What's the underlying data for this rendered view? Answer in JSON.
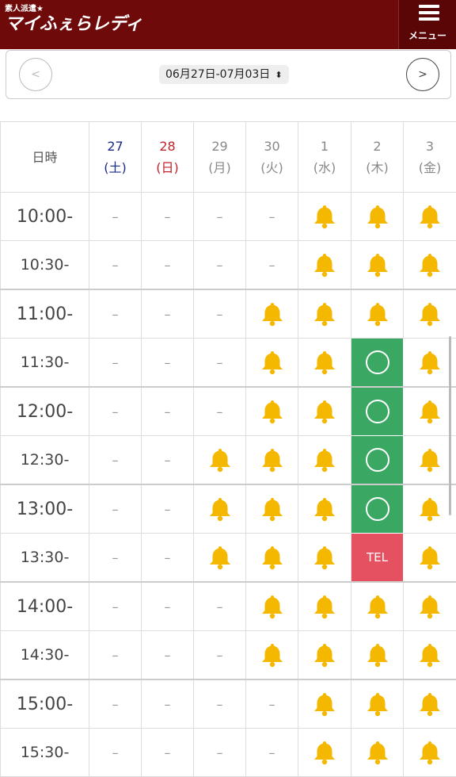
{
  "header": {
    "logo_sub": "素人派遣★",
    "logo_main": "マイふぇらレディ",
    "menu_label": "メニュー",
    "menu_icon": "hamburger-icon"
  },
  "date_nav": {
    "prev_label": "<",
    "next_label": ">",
    "range": "06月27日-07月03日",
    "selector_icon": "up-down-chevron-icon"
  },
  "table": {
    "corner_label": "日時",
    "days": [
      {
        "date": "27",
        "weekday": "(土)",
        "style": "sat"
      },
      {
        "date": "28",
        "weekday": "(日)",
        "style": "sun"
      },
      {
        "date": "29",
        "weekday": "(月)",
        "style": "normal"
      },
      {
        "date": "30",
        "weekday": "(火)",
        "style": "normal"
      },
      {
        "date": "1",
        "weekday": "(水)",
        "style": "normal"
      },
      {
        "date": "2",
        "weekday": "(木)",
        "style": "normal"
      },
      {
        "date": "3",
        "weekday": "(金)",
        "style": "normal"
      }
    ],
    "symbols": {
      "dash": "–",
      "tel": "TEL",
      "bell": "bell-icon",
      "open": "circle-icon"
    },
    "rows": [
      {
        "time": "10:00-",
        "cells": [
          "dash",
          "dash",
          "dash",
          "dash",
          "bell",
          "bell",
          "bell"
        ]
      },
      {
        "time": "10:30-",
        "cells": [
          "dash",
          "dash",
          "dash",
          "dash",
          "bell",
          "bell",
          "bell"
        ]
      },
      {
        "time": "11:00-",
        "cells": [
          "dash",
          "dash",
          "dash",
          "bell",
          "bell",
          "bell",
          "bell"
        ]
      },
      {
        "time": "11:30-",
        "cells": [
          "dash",
          "dash",
          "dash",
          "bell",
          "bell",
          "open",
          "bell"
        ]
      },
      {
        "time": "12:00-",
        "cells": [
          "dash",
          "dash",
          "dash",
          "bell",
          "bell",
          "open",
          "bell"
        ]
      },
      {
        "time": "12:30-",
        "cells": [
          "dash",
          "dash",
          "bell",
          "bell",
          "bell",
          "open",
          "bell"
        ]
      },
      {
        "time": "13:00-",
        "cells": [
          "dash",
          "dash",
          "bell",
          "bell",
          "bell",
          "open",
          "bell"
        ]
      },
      {
        "time": "13:30-",
        "cells": [
          "dash",
          "dash",
          "bell",
          "bell",
          "bell",
          "tel",
          "bell"
        ]
      },
      {
        "time": "14:00-",
        "cells": [
          "dash",
          "dash",
          "dash",
          "bell",
          "bell",
          "bell",
          "bell"
        ]
      },
      {
        "time": "14:30-",
        "cells": [
          "dash",
          "dash",
          "dash",
          "bell",
          "bell",
          "bell",
          "bell"
        ]
      },
      {
        "time": "15:00-",
        "cells": [
          "dash",
          "dash",
          "dash",
          "dash",
          "bell",
          "bell",
          "bell"
        ]
      },
      {
        "time": "15:30-",
        "cells": [
          "dash",
          "dash",
          "dash",
          "dash",
          "bell",
          "bell",
          "bell"
        ]
      }
    ]
  },
  "colors": {
    "header_bg": "#6e0a0a",
    "bell": "#f5b800",
    "available": "#3aa862",
    "tel": "#e55160",
    "saturday": "#1a2a8a",
    "sunday": "#c0232a"
  }
}
